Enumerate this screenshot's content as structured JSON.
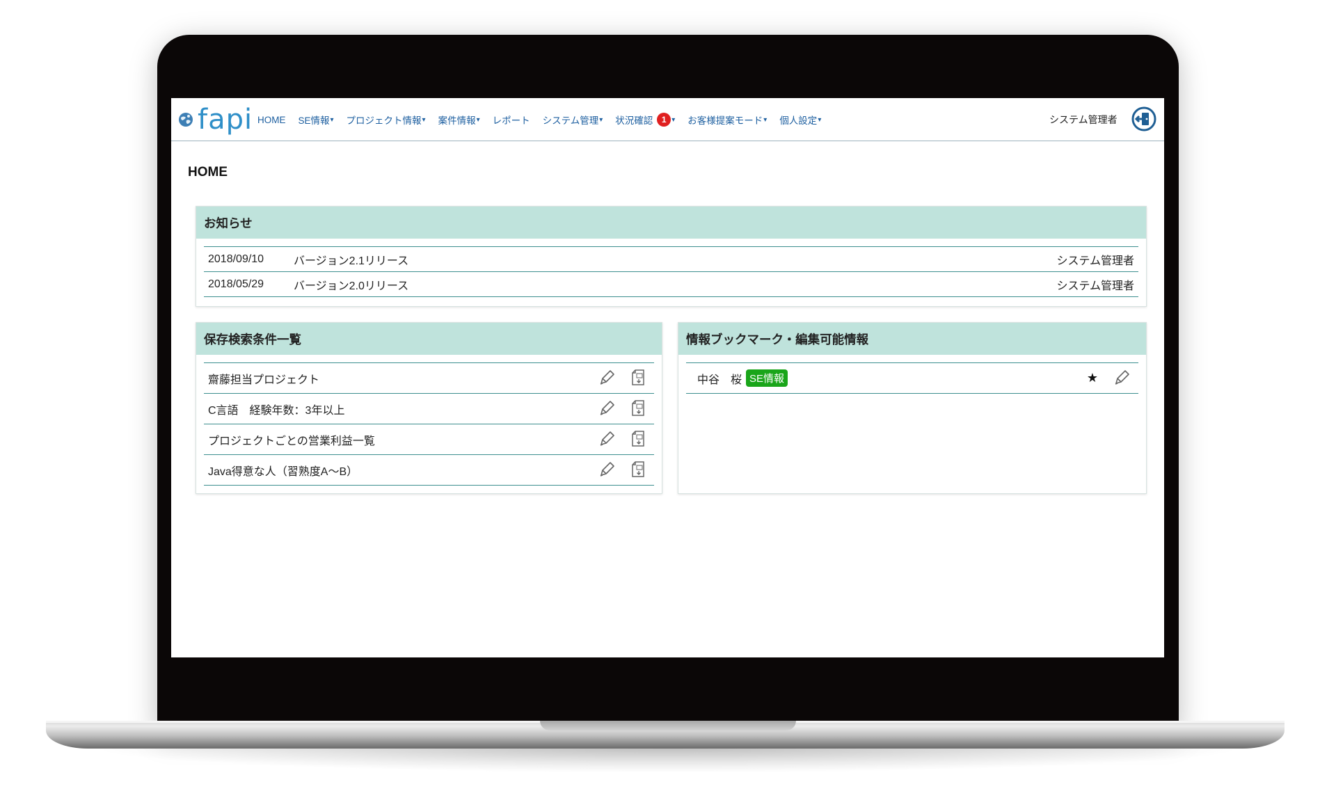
{
  "navbar": {
    "logo_text": "fapi",
    "items": [
      {
        "label": "HOME",
        "dropdown": false
      },
      {
        "label": "SE情報",
        "dropdown": true
      },
      {
        "label": "プロジェクト情報",
        "dropdown": true
      },
      {
        "label": "案件情報",
        "dropdown": true
      },
      {
        "label": "レポート",
        "dropdown": false
      },
      {
        "label": "システム管理",
        "dropdown": true
      },
      {
        "label": "状況確認",
        "dropdown": true,
        "badge": "1"
      },
      {
        "label": "お客様提案モード",
        "dropdown": true
      },
      {
        "label": "個人設定",
        "dropdown": true
      }
    ],
    "dropdown_arrow": "▾",
    "user_name": "システム管理者",
    "logout_icon": "logout-icon"
  },
  "page": {
    "title": "HOME"
  },
  "news": {
    "title": "お知らせ",
    "rows": [
      {
        "date": "2018/09/10",
        "title": "バージョン2.1リリース",
        "author": "システム管理者"
      },
      {
        "date": "2018/05/29",
        "title": "バージョン2.0リリース",
        "author": "システム管理者"
      }
    ]
  },
  "saved_searches": {
    "title": "保存検索条件一覧",
    "rows": [
      {
        "label": "齋藤担当プロジェクト"
      },
      {
        "label": "C言語　経験年数：3年以上"
      },
      {
        "label": "プロジェクトごとの営業利益一覧"
      },
      {
        "label": "Java得意な人（習熟度A～B）"
      }
    ],
    "edit_icon": "pencil-icon",
    "export_icon": "excel-export-icon"
  },
  "bookmarks": {
    "title": "情報ブックマーク・編集可能情報",
    "rows": [
      {
        "name": "中谷　桜",
        "tag": "SE情報",
        "star": "★"
      }
    ]
  },
  "colors": {
    "panel_header_bg": "#bfe3dc",
    "row_border": "#3b8e8e",
    "nav_link": "#1d5fa0",
    "badge": "#e02020",
    "tag_green": "#1aa51a"
  }
}
